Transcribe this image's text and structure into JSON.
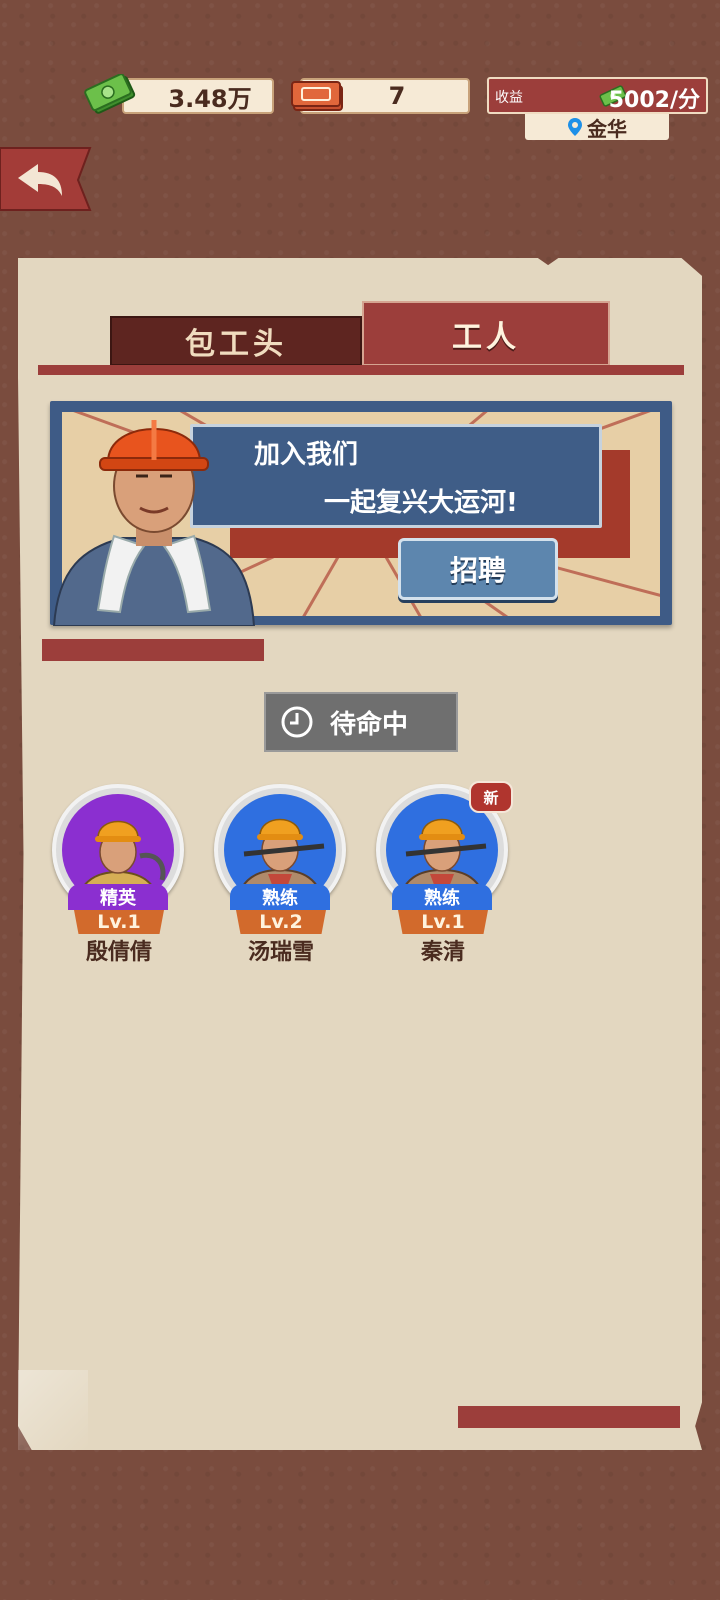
{
  "resources": {
    "cash": "3.48万",
    "tickets": "7",
    "income_label": "收益",
    "income_value": "5002/分",
    "location": "金华"
  },
  "tabs": [
    {
      "label": "包工头",
      "active": false
    },
    {
      "label": "工人",
      "active": true
    }
  ],
  "banner": {
    "line1": "加入我们",
    "line2": "一起复兴大运河!",
    "recruit_label": "招聘"
  },
  "standby_label": "待命中",
  "workers": [
    {
      "rank": "精英",
      "rank_color": "#8b2fd0",
      "level": "Lv.1",
      "name": "殷倩倩",
      "is_new": false
    },
    {
      "rank": "熟练",
      "rank_color": "#2f6fe0",
      "level": "Lv.2",
      "name": "汤瑞雪",
      "is_new": false
    },
    {
      "rank": "熟练",
      "rank_color": "#2f6fe0",
      "level": "Lv.1",
      "name": "秦清",
      "is_new": true
    }
  ],
  "new_badge": "新",
  "colors": {
    "accent_red": "#9c3e3b",
    "panel_paper": "#e3d7c0",
    "background": "#7a4c3e",
    "banner_blue": "#3e5b86"
  },
  "icons": [
    "cash-icon",
    "ticket-icon",
    "location-pin-icon",
    "back-arrow-icon",
    "clock-icon"
  ]
}
